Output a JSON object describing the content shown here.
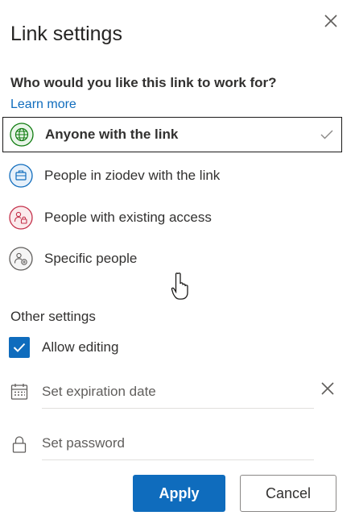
{
  "dialog": {
    "title": "Link settings",
    "close_icon": "close-icon"
  },
  "question": "Who would you like this link to work for?",
  "learn_more": "Learn more",
  "options": [
    {
      "label": "Anyone with the link",
      "icon": "globe-icon",
      "selected": true,
      "color": "#107c10"
    },
    {
      "label": "People in ziodev with the link",
      "icon": "organization-icon",
      "selected": false,
      "color": "#0f6cbd"
    },
    {
      "label": "People with existing access",
      "icon": "people-lock-icon",
      "selected": false,
      "color": "#c4314b"
    },
    {
      "label": "Specific people",
      "icon": "people-add-icon",
      "selected": false,
      "color": "#605e5c"
    }
  ],
  "other_settings": {
    "title": "Other settings",
    "allow_editing": {
      "label": "Allow editing",
      "checked": true
    },
    "expiration": {
      "placeholder": "Set expiration date",
      "icon": "calendar-icon"
    },
    "password": {
      "placeholder": "Set password",
      "icon": "lock-icon"
    }
  },
  "buttons": {
    "apply": "Apply",
    "cancel": "Cancel"
  },
  "colors": {
    "accent": "#0f6cbd",
    "text": "#323130"
  }
}
